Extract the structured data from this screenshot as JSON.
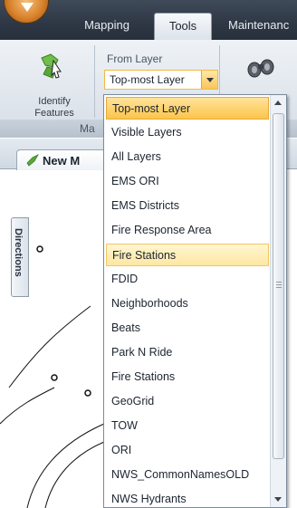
{
  "ribbon": {
    "tabs": [
      {
        "label": "Mapping"
      },
      {
        "label": "Tools"
      },
      {
        "label": "Maintenanc"
      }
    ],
    "identify_label": "Identify Features",
    "from_layer_label": "From Layer",
    "from_layer_value": "Top-most Layer",
    "group_label": "Ma"
  },
  "document": {
    "tab_label": "New M",
    "side_tab_label": "Directions"
  },
  "dropdown": {
    "items": [
      {
        "label": "Top-most Layer",
        "state": "selected"
      },
      {
        "label": "Visible Layers",
        "state": "normal"
      },
      {
        "label": "All Layers",
        "state": "normal"
      },
      {
        "label": "EMS ORI",
        "state": "normal"
      },
      {
        "label": "EMS Districts",
        "state": "normal"
      },
      {
        "label": "Fire Response Area",
        "state": "normal"
      },
      {
        "label": "Fire Stations",
        "state": "hover"
      },
      {
        "label": "FDID",
        "state": "normal"
      },
      {
        "label": "Neighborhoods",
        "state": "normal"
      },
      {
        "label": "Beats",
        "state": "normal"
      },
      {
        "label": "Park N Ride",
        "state": "normal"
      },
      {
        "label": "Fire Stations",
        "state": "normal"
      },
      {
        "label": "GeoGrid",
        "state": "normal"
      },
      {
        "label": "TOW",
        "state": "normal"
      },
      {
        "label": "ORI",
        "state": "normal"
      },
      {
        "label": "NWS_CommonNamesOLD",
        "state": "normal"
      },
      {
        "label": "NWS Hydrants",
        "state": "normal"
      }
    ]
  },
  "colors": {
    "selected": "#fbc54c",
    "hover": "#fde7a2",
    "tab_bar": "#2e3744"
  },
  "icons": {
    "identify": "identify-features-icon",
    "tool": "binoculars-icon",
    "doc_tab": "map-tab-icon"
  }
}
